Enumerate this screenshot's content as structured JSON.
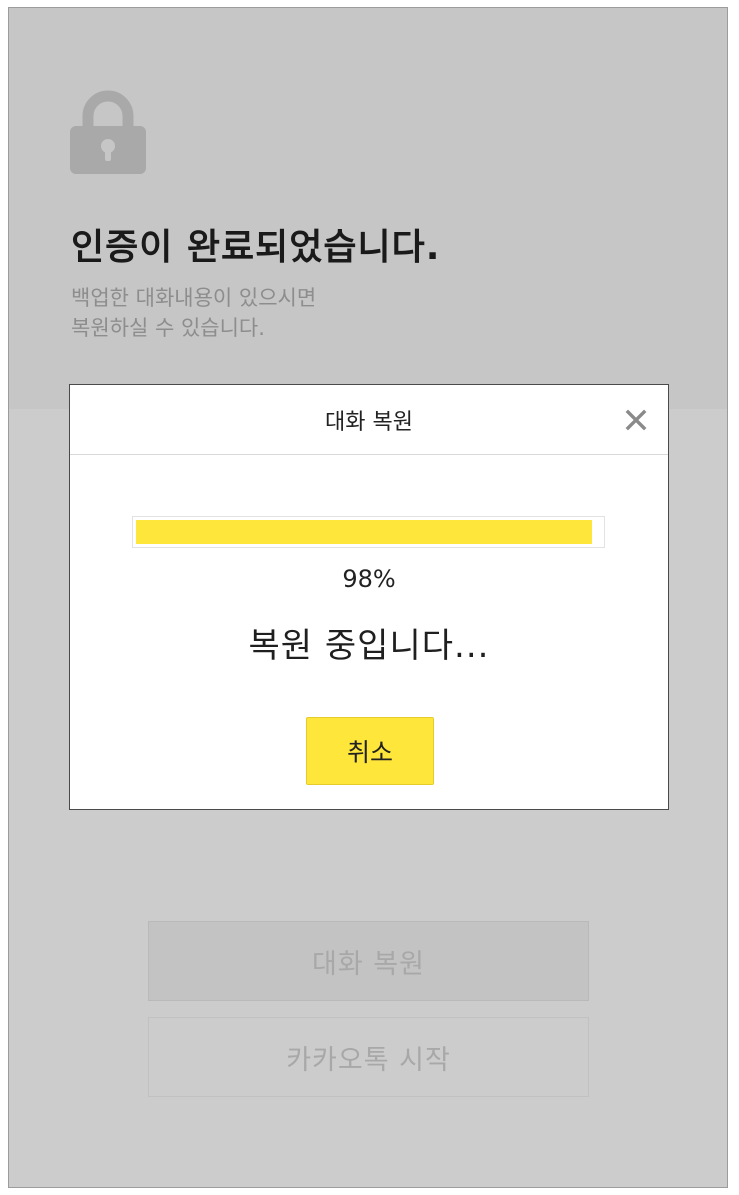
{
  "header": {
    "title": "인증이 완료되었습니다.",
    "subtitle_line1": "백업한 대화내용이 있으시면",
    "subtitle_line2": "복원하실 수 있습니다."
  },
  "buttons": {
    "restore": "대화 복원",
    "start": "카카오톡 시작"
  },
  "modal": {
    "title": "대화 복원",
    "progress_percent": 98,
    "progress_label": "98%",
    "status": "복원 중입니다...",
    "cancel": "취소"
  },
  "colors": {
    "accent": "#ffe63b",
    "overlay": "#cccccc",
    "lock_icon": "#a9a9a9"
  },
  "icons": {
    "lock": "lock-icon",
    "close": "close-icon"
  }
}
